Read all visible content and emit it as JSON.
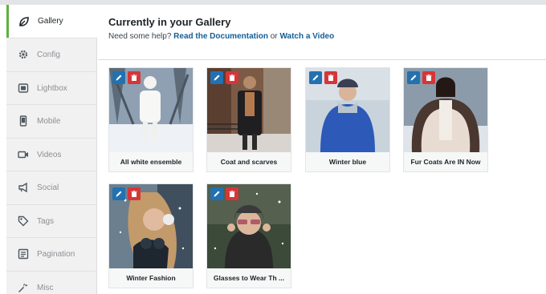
{
  "sidebar": {
    "items": [
      {
        "label": "Gallery",
        "icon": "leaf-icon"
      },
      {
        "label": "Config",
        "icon": "gear-icon"
      },
      {
        "label": "Lightbox",
        "icon": "lightbox-icon"
      },
      {
        "label": "Mobile",
        "icon": "mobile-icon"
      },
      {
        "label": "Videos",
        "icon": "video-icon"
      },
      {
        "label": "Social",
        "icon": "megaphone-icon"
      },
      {
        "label": "Tags",
        "icon": "tag-icon"
      },
      {
        "label": "Pagination",
        "icon": "pagination-icon"
      },
      {
        "label": "Misc",
        "icon": "wrench-icon"
      }
    ],
    "active": "Gallery"
  },
  "main": {
    "title": "Currently in your Gallery",
    "help_prefix": "Need some help?",
    "doc_link": "Read the Documentation",
    "help_or": "or",
    "video_link": "Watch a Video"
  },
  "gallery": {
    "images": [
      {
        "caption": "All white ensemble"
      },
      {
        "caption": "Coat and scarves"
      },
      {
        "caption": "Winter blue"
      },
      {
        "caption": "Fur Coats Are IN Now"
      },
      {
        "caption": "Winter Fashion"
      },
      {
        "caption": "Glasses to Wear Th ..."
      }
    ]
  },
  "colors": {
    "accent_green": "#5fb143",
    "edit_blue": "#2271b1",
    "delete_red": "#d63638",
    "link": "#135e96"
  }
}
